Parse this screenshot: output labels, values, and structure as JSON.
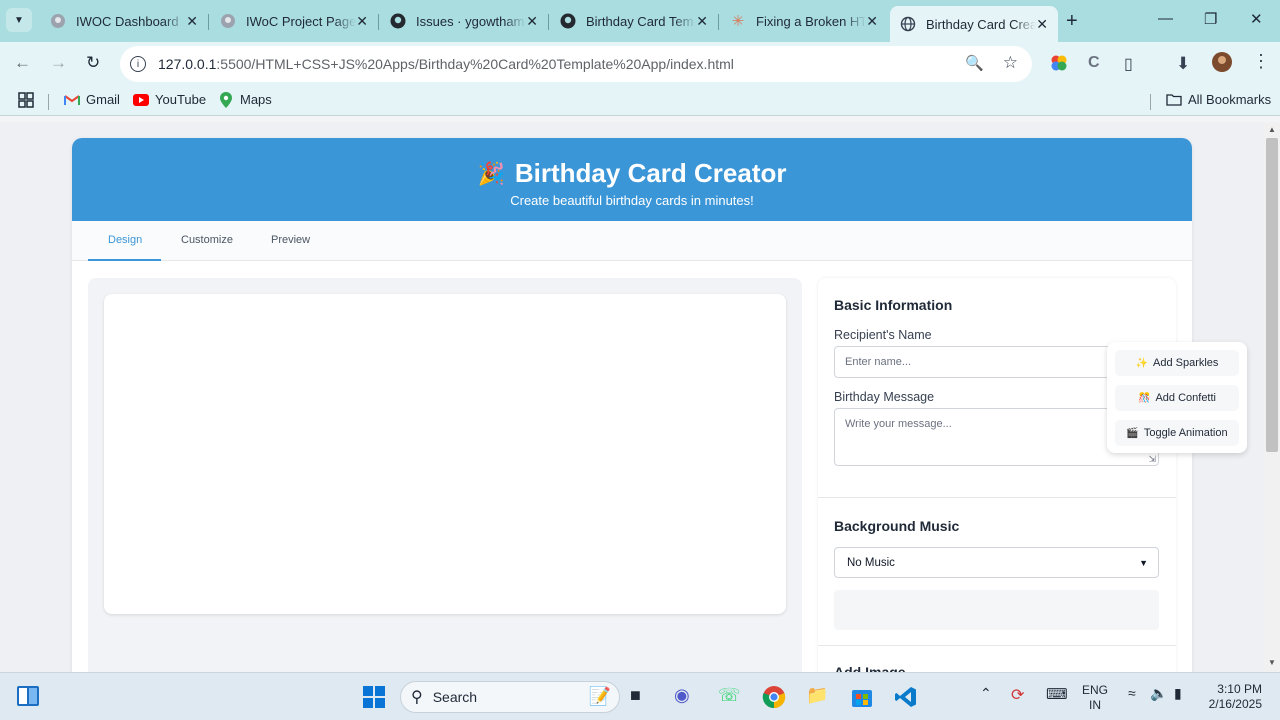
{
  "browser": {
    "tabs": [
      {
        "title": "IWOC Dashboard",
        "icon": "github-avatar-icon",
        "active": false
      },
      {
        "title": "IWoC Project Page",
        "icon": "github-avatar-icon",
        "active": false
      },
      {
        "title": "Issues · ygowtham",
        "icon": "github-icon",
        "active": false
      },
      {
        "title": "Birthday Card Tem",
        "icon": "github-icon",
        "active": false
      },
      {
        "title": "Fixing a Broken HT",
        "icon": "ai-star-icon",
        "active": false
      },
      {
        "title": "Birthday Card Crea",
        "icon": "globe-icon",
        "active": true
      }
    ],
    "url_host": "127.0.0.1",
    "url_path": ":5500/HTML+CSS+JS%20Apps/Birthday%20Card%20Template%20App/index.html",
    "bookmarks": [
      {
        "label": "Gmail",
        "icon": "gmail-icon"
      },
      {
        "label": "YouTube",
        "icon": "youtube-icon"
      },
      {
        "label": "Maps",
        "icon": "maps-icon"
      }
    ],
    "all_bookmarks": "All Bookmarks"
  },
  "app": {
    "title": "Birthday Card Creator",
    "subtitle": "Create beautiful birthday cards in minutes!",
    "header_color": "#3b96d8",
    "tabs": [
      "Design",
      "Customize",
      "Preview"
    ],
    "active_tab": "Design",
    "basic_info": {
      "title": "Basic Information",
      "recipient_label": "Recipient's Name",
      "recipient_placeholder": "Enter name...",
      "message_label": "Birthday Message",
      "message_placeholder": "Write your message..."
    },
    "music": {
      "title": "Background Music",
      "selected": "No Music"
    },
    "add_image_title": "Add Image",
    "floating_actions": [
      {
        "label": "Add Sparkles",
        "icon": "sparkles-icon"
      },
      {
        "label": "Add Confetti",
        "icon": "confetti-icon"
      },
      {
        "label": "Toggle Animation",
        "icon": "animation-icon"
      }
    ]
  },
  "taskbar": {
    "search_label": "Search",
    "lang_top": "ENG",
    "lang_bottom": "IN",
    "time": "3:10 PM",
    "date": "2/16/2025"
  }
}
